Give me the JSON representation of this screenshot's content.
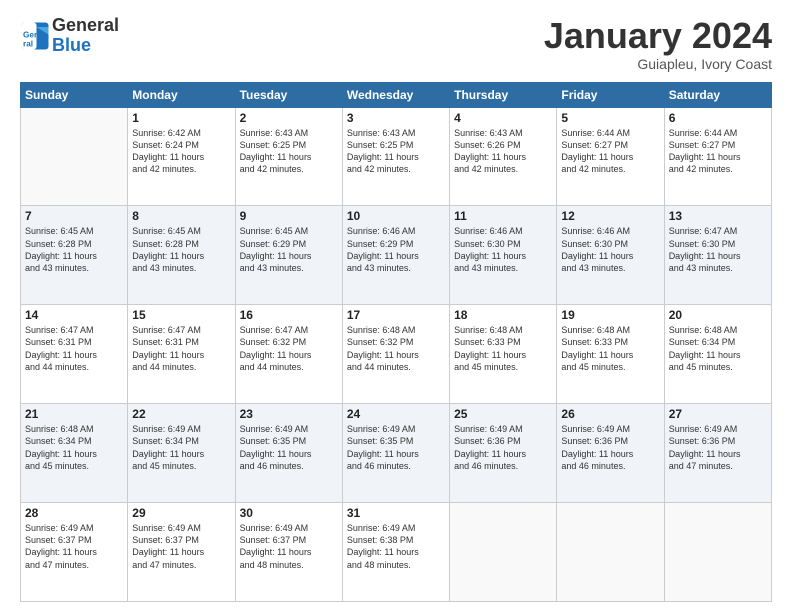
{
  "header": {
    "logo_line1": "General",
    "logo_line2": "Blue",
    "title": "January 2024",
    "subtitle": "Guiapleu, Ivory Coast"
  },
  "days_of_week": [
    "Sunday",
    "Monday",
    "Tuesday",
    "Wednesday",
    "Thursday",
    "Friday",
    "Saturday"
  ],
  "weeks": [
    [
      {
        "day": "",
        "info": ""
      },
      {
        "day": "1",
        "info": "Sunrise: 6:42 AM\nSunset: 6:24 PM\nDaylight: 11 hours\nand 42 minutes."
      },
      {
        "day": "2",
        "info": "Sunrise: 6:43 AM\nSunset: 6:25 PM\nDaylight: 11 hours\nand 42 minutes."
      },
      {
        "day": "3",
        "info": "Sunrise: 6:43 AM\nSunset: 6:25 PM\nDaylight: 11 hours\nand 42 minutes."
      },
      {
        "day": "4",
        "info": "Sunrise: 6:43 AM\nSunset: 6:26 PM\nDaylight: 11 hours\nand 42 minutes."
      },
      {
        "day": "5",
        "info": "Sunrise: 6:44 AM\nSunset: 6:27 PM\nDaylight: 11 hours\nand 42 minutes."
      },
      {
        "day": "6",
        "info": "Sunrise: 6:44 AM\nSunset: 6:27 PM\nDaylight: 11 hours\nand 42 minutes."
      }
    ],
    [
      {
        "day": "7",
        "info": "Sunrise: 6:45 AM\nSunset: 6:28 PM\nDaylight: 11 hours\nand 43 minutes."
      },
      {
        "day": "8",
        "info": "Sunrise: 6:45 AM\nSunset: 6:28 PM\nDaylight: 11 hours\nand 43 minutes."
      },
      {
        "day": "9",
        "info": "Sunrise: 6:45 AM\nSunset: 6:29 PM\nDaylight: 11 hours\nand 43 minutes."
      },
      {
        "day": "10",
        "info": "Sunrise: 6:46 AM\nSunset: 6:29 PM\nDaylight: 11 hours\nand 43 minutes."
      },
      {
        "day": "11",
        "info": "Sunrise: 6:46 AM\nSunset: 6:30 PM\nDaylight: 11 hours\nand 43 minutes."
      },
      {
        "day": "12",
        "info": "Sunrise: 6:46 AM\nSunset: 6:30 PM\nDaylight: 11 hours\nand 43 minutes."
      },
      {
        "day": "13",
        "info": "Sunrise: 6:47 AM\nSunset: 6:30 PM\nDaylight: 11 hours\nand 43 minutes."
      }
    ],
    [
      {
        "day": "14",
        "info": "Sunrise: 6:47 AM\nSunset: 6:31 PM\nDaylight: 11 hours\nand 44 minutes."
      },
      {
        "day": "15",
        "info": "Sunrise: 6:47 AM\nSunset: 6:31 PM\nDaylight: 11 hours\nand 44 minutes."
      },
      {
        "day": "16",
        "info": "Sunrise: 6:47 AM\nSunset: 6:32 PM\nDaylight: 11 hours\nand 44 minutes."
      },
      {
        "day": "17",
        "info": "Sunrise: 6:48 AM\nSunset: 6:32 PM\nDaylight: 11 hours\nand 44 minutes."
      },
      {
        "day": "18",
        "info": "Sunrise: 6:48 AM\nSunset: 6:33 PM\nDaylight: 11 hours\nand 45 minutes."
      },
      {
        "day": "19",
        "info": "Sunrise: 6:48 AM\nSunset: 6:33 PM\nDaylight: 11 hours\nand 45 minutes."
      },
      {
        "day": "20",
        "info": "Sunrise: 6:48 AM\nSunset: 6:34 PM\nDaylight: 11 hours\nand 45 minutes."
      }
    ],
    [
      {
        "day": "21",
        "info": "Sunrise: 6:48 AM\nSunset: 6:34 PM\nDaylight: 11 hours\nand 45 minutes."
      },
      {
        "day": "22",
        "info": "Sunrise: 6:49 AM\nSunset: 6:34 PM\nDaylight: 11 hours\nand 45 minutes."
      },
      {
        "day": "23",
        "info": "Sunrise: 6:49 AM\nSunset: 6:35 PM\nDaylight: 11 hours\nand 46 minutes."
      },
      {
        "day": "24",
        "info": "Sunrise: 6:49 AM\nSunset: 6:35 PM\nDaylight: 11 hours\nand 46 minutes."
      },
      {
        "day": "25",
        "info": "Sunrise: 6:49 AM\nSunset: 6:36 PM\nDaylight: 11 hours\nand 46 minutes."
      },
      {
        "day": "26",
        "info": "Sunrise: 6:49 AM\nSunset: 6:36 PM\nDaylight: 11 hours\nand 46 minutes."
      },
      {
        "day": "27",
        "info": "Sunrise: 6:49 AM\nSunset: 6:36 PM\nDaylight: 11 hours\nand 47 minutes."
      }
    ],
    [
      {
        "day": "28",
        "info": "Sunrise: 6:49 AM\nSunset: 6:37 PM\nDaylight: 11 hours\nand 47 minutes."
      },
      {
        "day": "29",
        "info": "Sunrise: 6:49 AM\nSunset: 6:37 PM\nDaylight: 11 hours\nand 47 minutes."
      },
      {
        "day": "30",
        "info": "Sunrise: 6:49 AM\nSunset: 6:37 PM\nDaylight: 11 hours\nand 48 minutes."
      },
      {
        "day": "31",
        "info": "Sunrise: 6:49 AM\nSunset: 6:38 PM\nDaylight: 11 hours\nand 48 minutes."
      },
      {
        "day": "",
        "info": ""
      },
      {
        "day": "",
        "info": ""
      },
      {
        "day": "",
        "info": ""
      }
    ]
  ]
}
